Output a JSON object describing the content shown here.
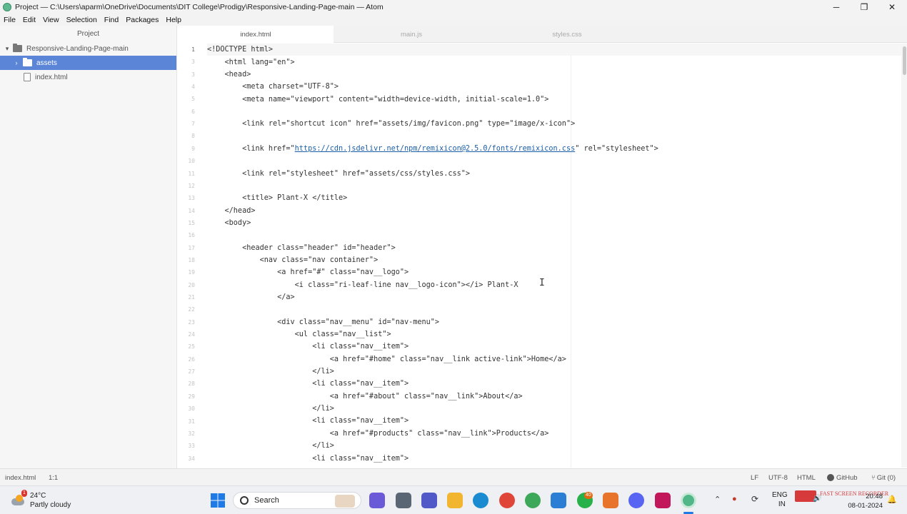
{
  "window": {
    "title": "Project — C:\\Users\\aparm\\OneDrive\\Documents\\DIT College\\Prodigy\\Responsive-Landing-Page-main — Atom",
    "minimize": "─",
    "maximize": "❐",
    "close": "✕"
  },
  "menu": [
    "File",
    "Edit",
    "View",
    "Selection",
    "Find",
    "Packages",
    "Help"
  ],
  "tree": {
    "header": "Project",
    "root": "Responsive-Landing-Page-main",
    "folder": "assets",
    "file": "index.html"
  },
  "tabs": [
    "index.html",
    "main.js",
    "styles.css"
  ],
  "editor": {
    "lines": [
      "<!DOCTYPE html>",
      "    <html lang=\"en\">",
      "    <head>",
      "        <meta charset=\"UTF-8\">",
      "        <meta name=\"viewport\" content=\"width=device-width, initial-scale=1.0\">",
      "",
      "        <link rel=\"shortcut icon\" href=\"assets/img/favicon.png\" type=\"image/x-icon\">",
      "",
      "        <link href=\"",
      "",
      "        <link rel=\"stylesheet\" href=\"assets/css/styles.css\">",
      "",
      "        <title> Plant-X </title>",
      "    </head>",
      "    <body>",
      "",
      "        <header class=\"header\" id=\"header\">",
      "            <nav class=\"nav container\">",
      "                <a href=\"#\" class=\"nav__logo\">",
      "                    <i class=\"ri-leaf-line nav__logo-icon\"></i> Plant-X",
      "                </a>",
      "",
      "                <div class=\"nav__menu\" id=\"nav-menu\">",
      "                    <ul class=\"nav__list\">",
      "                        <li class=\"nav__item\">",
      "                            <a href=\"#home\" class=\"nav__link active-link\">Home</a>",
      "                        </li>",
      "                        <li class=\"nav__item\">",
      "                            <a href=\"#about\" class=\"nav__link\">About</a>",
      "                        </li>",
      "                        <li class=\"nav__item\">",
      "                            <a href=\"#products\" class=\"nav__link\">Products</a>",
      "                        </li>",
      "                        <li class=\"nav__item\">"
    ],
    "line_numbers": [
      "1",
      "3",
      "3",
      "4",
      "5",
      "6",
      "7",
      "8",
      "9",
      "10",
      "11",
      "12",
      "13",
      "14",
      "15",
      "16",
      "17",
      "18",
      "19",
      "20",
      "21",
      "22",
      "23",
      "24",
      "25",
      "26",
      "27",
      "28",
      "29",
      "30",
      "31",
      "32",
      "33",
      "34"
    ],
    "link_url": "https://cdn.jsdelivr.net/npm/remixicon@2.5.0/fonts/remixicon.css",
    "link_suffix": "\" rel=\"stylesheet\">",
    "ibeam": "I"
  },
  "status": {
    "file": "index.html",
    "cursor": "1:1",
    "line_ending": "LF",
    "encoding": "UTF-8",
    "grammar": "HTML",
    "github": "GitHub",
    "git": "Git (0)"
  },
  "taskbar": {
    "weather_temp": "24°C",
    "weather_desc": "Partly cloudy",
    "weather_badge": "1",
    "search_label": "Search",
    "whatsapp_badge": "40",
    "lang_top": "ENG",
    "lang_bottom": "IN",
    "time": "20:48",
    "date": "08-01-2024",
    "recorder_watermark": "FAST SCREEN RECORDER"
  },
  "colors": {
    "selection": "#5b86d8",
    "link": "#1a5fa8",
    "taskbar_bg": "#eef0f4"
  }
}
